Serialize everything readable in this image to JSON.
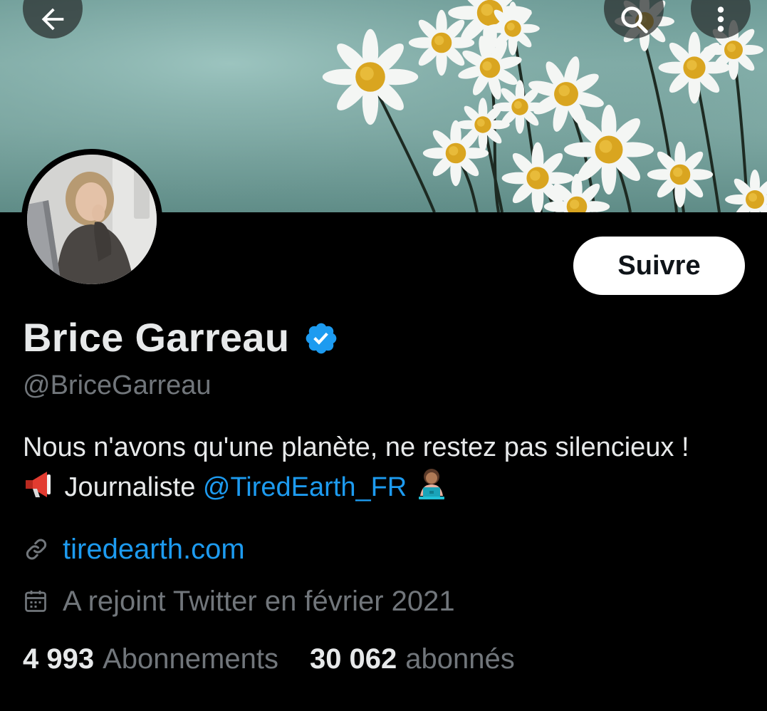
{
  "header": {
    "back_icon": "arrow-left-icon",
    "search_icon": "search-icon",
    "more_icon": "more-vertical-icon"
  },
  "profile": {
    "display_name": "Brice Garreau",
    "verified": true,
    "handle": "@BriceGarreau",
    "follow_label": "Suivre",
    "bio": {
      "text_1": "Nous n'avons qu'une planète, ne restez pas silencieux !",
      "emoji_1": "loudspeaker-emoji",
      "text_2": " Journaliste ",
      "mention": "@TiredEarth_FR",
      "emoji_2": "technologist-emoji"
    },
    "website": "tiredearth.com",
    "joined": "A rejoint Twitter en février 2021",
    "following_count": "4 993",
    "following_label": "Abonnements",
    "followers_count": "30 062",
    "followers_label": "abonnés"
  },
  "colors": {
    "background": "#000000",
    "text_primary": "#e7e9ea",
    "text_secondary": "#71767b",
    "accent": "#1d9bf0"
  }
}
